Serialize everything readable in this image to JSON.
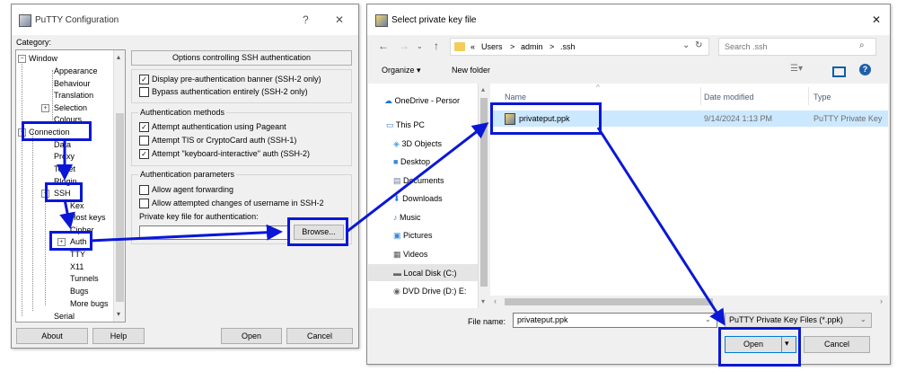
{
  "putty": {
    "title": "PuTTY Configuration",
    "help_glyph": "?",
    "close_glyph": "✕",
    "category_label": "Category:",
    "tree": [
      {
        "label": "Window",
        "expand": "−"
      },
      {
        "label": "Appearance"
      },
      {
        "label": "Behaviour"
      },
      {
        "label": "Translation"
      },
      {
        "label": "Selection",
        "expand": "+"
      },
      {
        "label": "Colours"
      },
      {
        "label": "Connection",
        "expand": "−"
      },
      {
        "label": "Data"
      },
      {
        "label": "Proxy"
      },
      {
        "label": "Telnet"
      },
      {
        "label": "Rlogin"
      },
      {
        "label": "SSH",
        "expand": "−"
      },
      {
        "label": "Kex"
      },
      {
        "label": "Host keys"
      },
      {
        "label": "Cipher"
      },
      {
        "label": "Auth",
        "expand": "+"
      },
      {
        "label": "TTY"
      },
      {
        "label": "X11"
      },
      {
        "label": "Tunnels"
      },
      {
        "label": "Bugs"
      },
      {
        "label": "More bugs"
      },
      {
        "label": "Serial"
      }
    ],
    "panel_header": "Options controlling SSH authentication",
    "group1": [
      {
        "label": "Display pre-authentication banner (SSH-2 only)",
        "checked": true
      },
      {
        "label": "Bypass authentication entirely (SSH-2 only)",
        "checked": false
      }
    ],
    "auth_methods_title": "Authentication methods",
    "auth_methods": [
      {
        "label": "Attempt authentication using Pageant",
        "checked": true
      },
      {
        "label": "Attempt TIS or CryptoCard auth (SSH-1)",
        "checked": false
      },
      {
        "label": "Attempt \"keyboard-interactive\" auth (SSH-2)",
        "checked": true
      }
    ],
    "auth_params_title": "Authentication parameters",
    "auth_params": [
      {
        "label": "Allow agent forwarding",
        "checked": false
      },
      {
        "label": "Allow attempted changes of username in SSH-2",
        "checked": false
      }
    ],
    "keyfile_label": "Private key file for authentication:",
    "keyfile_value": "",
    "browse_button": "Browse...",
    "about_button": "About",
    "help_button": "Help",
    "open_button": "Open",
    "cancel_button": "Cancel"
  },
  "dialog": {
    "title": "Select private key file",
    "close_glyph": "✕",
    "breadcrumb": [
      "«",
      "Users",
      ">",
      "admin",
      ">",
      ".ssh"
    ],
    "search_placeholder": "Search .ssh",
    "organize": "Organize ▾",
    "new_folder": "New folder",
    "nav": [
      {
        "label": "OneDrive - Persor",
        "icon": "cloud-icon"
      },
      {
        "label": "This PC",
        "icon": "computer-icon"
      },
      {
        "label": "3D Objects",
        "icon": "cube-icon"
      },
      {
        "label": "Desktop",
        "icon": "desktop-icon"
      },
      {
        "label": "Documents",
        "icon": "document-icon"
      },
      {
        "label": "Downloads",
        "icon": "download-icon"
      },
      {
        "label": "Music",
        "icon": "music-icon"
      },
      {
        "label": "Pictures",
        "icon": "picture-icon"
      },
      {
        "label": "Videos",
        "icon": "video-icon"
      },
      {
        "label": "Local Disk (C:)",
        "icon": "disk-icon"
      },
      {
        "label": "DVD Drive (D:) E:",
        "icon": "dvd-icon"
      }
    ],
    "columns": {
      "name": "Name",
      "date": "Date modified",
      "type": "Type"
    },
    "files": [
      {
        "name": "privateput.ppk",
        "date": "9/14/2024 1:13 PM",
        "type": "PuTTY Private Key"
      }
    ],
    "filename_label": "File name:",
    "filename_value": "privateput.ppk",
    "filter_value": "PuTTY Private Key Files (*.ppk)",
    "open_button": "Open",
    "cancel_button": "Cancel"
  },
  "colors": {
    "annotation": "#0a17d6",
    "selection": "#cce8ff",
    "accent": "#0078d7"
  }
}
